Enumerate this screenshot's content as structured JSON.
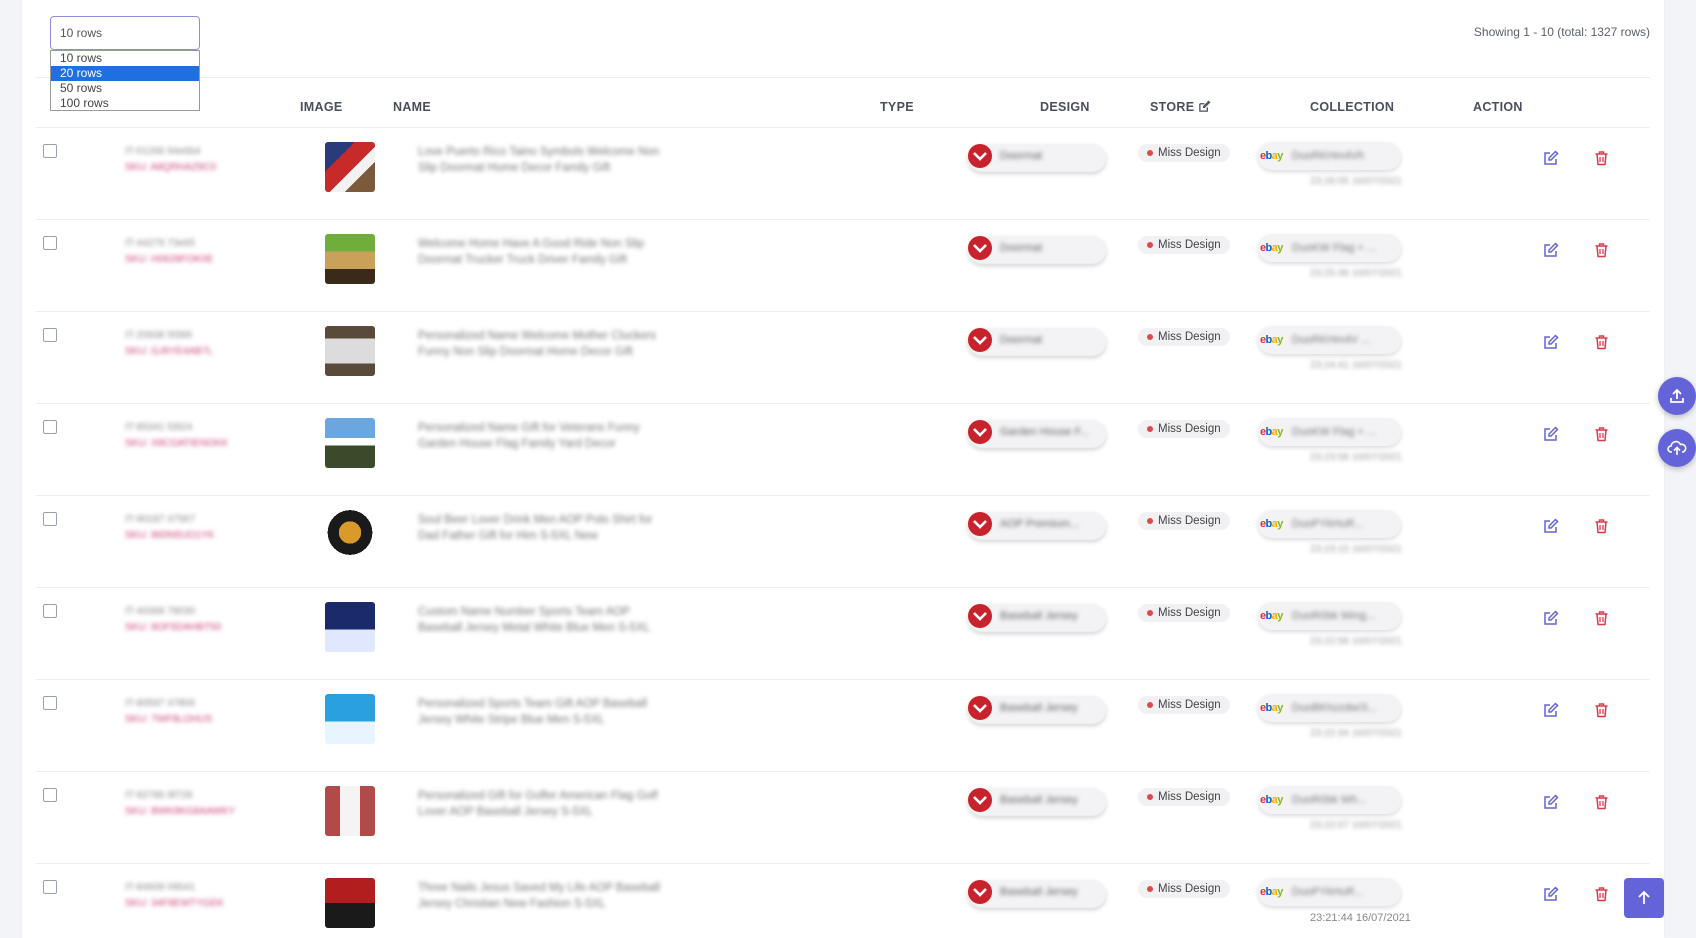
{
  "toolbar": {
    "rows_select_value": "10 rows",
    "rows_options": [
      "10 rows",
      "20 rows",
      "50 rows",
      "100 rows"
    ],
    "highlighted_option": "20 rows",
    "showing_text": "Showing 1 - 10 (total: 1327 rows)"
  },
  "table": {
    "headers": {
      "image": "IMAGE",
      "name": "NAME",
      "type": "TYPE",
      "design": "DESIGN",
      "store": "STORE",
      "collection": "COLLECTION",
      "action": "ACTION"
    },
    "rows": [
      {
        "id": "IT-01266 94e6b4",
        "sku": "SKU: A8QRHAZ9C0",
        "name": "Love Puerto Rico Taino Symbols Welcome Non Slip Doormat Home Decor Family Gift",
        "type": "Doormat",
        "design": "Miss Design",
        "store": "DuoRKHm4Vh",
        "date": "23:26:05 16/07/2021"
      },
      {
        "id": "IT-44279 73e65",
        "sku": "SKU: H0628FOK0E",
        "name": "Welcome Home Have A Good Ride Non Slip Doormat Trucker Truck Driver Family Gift",
        "type": "Doormat",
        "design": "Miss Design",
        "store": "DuoKW Flag + ...",
        "date": "23:25:36 16/07/2021"
      },
      {
        "id": "IT-20938 5f395",
        "sku": "SKU: GJ6YE4AB7L",
        "name": "Personalized Name Welcome Mother Cluckers Funny Non Slip Doormat Home Decor Gift",
        "type": "Doormat",
        "design": "Miss Design",
        "store": "DuoRKHm4V ...",
        "date": "23:24:41 16/07/2021"
      },
      {
        "id": "IT-85341 f2824",
        "sku": "SKU: X8COATIENOKK",
        "name": "Personalized Name Gift for Veterans Funny Garden House Flag Family Yard Decor",
        "type": "Garden House F...",
        "design": "Miss Design",
        "store": "DuoKW Flag + ...",
        "date": "23:23:58 16/07/2021"
      },
      {
        "id": "IT-90187 47567",
        "sku": "SKU: 860N5UO1YK",
        "name": "Soul Beer Lover Drink Men AOP Polo Shirt for Dad Father Gift for Him S-5XL New",
        "type": "AOP Premium...",
        "design": "Miss Design",
        "store": "DuoPYkHuR...",
        "date": "23:23:15 16/07/2021"
      },
      {
        "id": "IT-40368 78030",
        "sku": "SKU: 8OF5DAHBT50",
        "name": "Custom Name Number Sports Team AOP Baseball Jersey Metal White Blue Men S-5XL",
        "type": "Baseball Jersey",
        "design": "Miss Design",
        "store": "DuoR0bk Wing...",
        "date": "23:22:58 16/07/2021"
      },
      {
        "id": "IT-80597 47806",
        "sku": "SKU: 7WF8LOHUS",
        "name": "Personalized Sports Team Gift AOP Baseball Jersey White Stripe Blue Men S-5XL",
        "type": "Baseball Jersey",
        "design": "Miss Design",
        "store": "DuoBKhzzdw/3...",
        "date": "23:22:34 16/07/2021"
      },
      {
        "id": "IT-92786 9f728",
        "sku": "SKU: BWK8KG8AAWKY",
        "name": "Personalized Gift for Golfer American Flag Golf Lover AOP Baseball Jersey S-5XL",
        "type": "Baseball Jersey",
        "design": "Miss Design",
        "store": "DuoR0bk Wh...",
        "date": "23:22:07 16/07/2021"
      },
      {
        "id": "IT-84609 09541",
        "sku": "SKU: 34F8EWTYGEK",
        "name": "Three Nails Jesus Saved My Life AOP Baseball Jersey Christian New Fashion S-5XL",
        "type": "Baseball Jersey",
        "design": "Miss Design",
        "store": "DuoPYkHuR...",
        "date": "23:21:44 16/07/2021"
      }
    ]
  },
  "colors": {
    "accent": "#6464d8",
    "delete": "#e0394a",
    "badge_dot": "#e24848"
  },
  "icons": {
    "edit": "pencil-square-icon",
    "delete": "trash-icon",
    "upload": "upload-icon",
    "cloud_upload": "cloud-upload-icon",
    "scroll_top": "arrow-up-icon"
  }
}
